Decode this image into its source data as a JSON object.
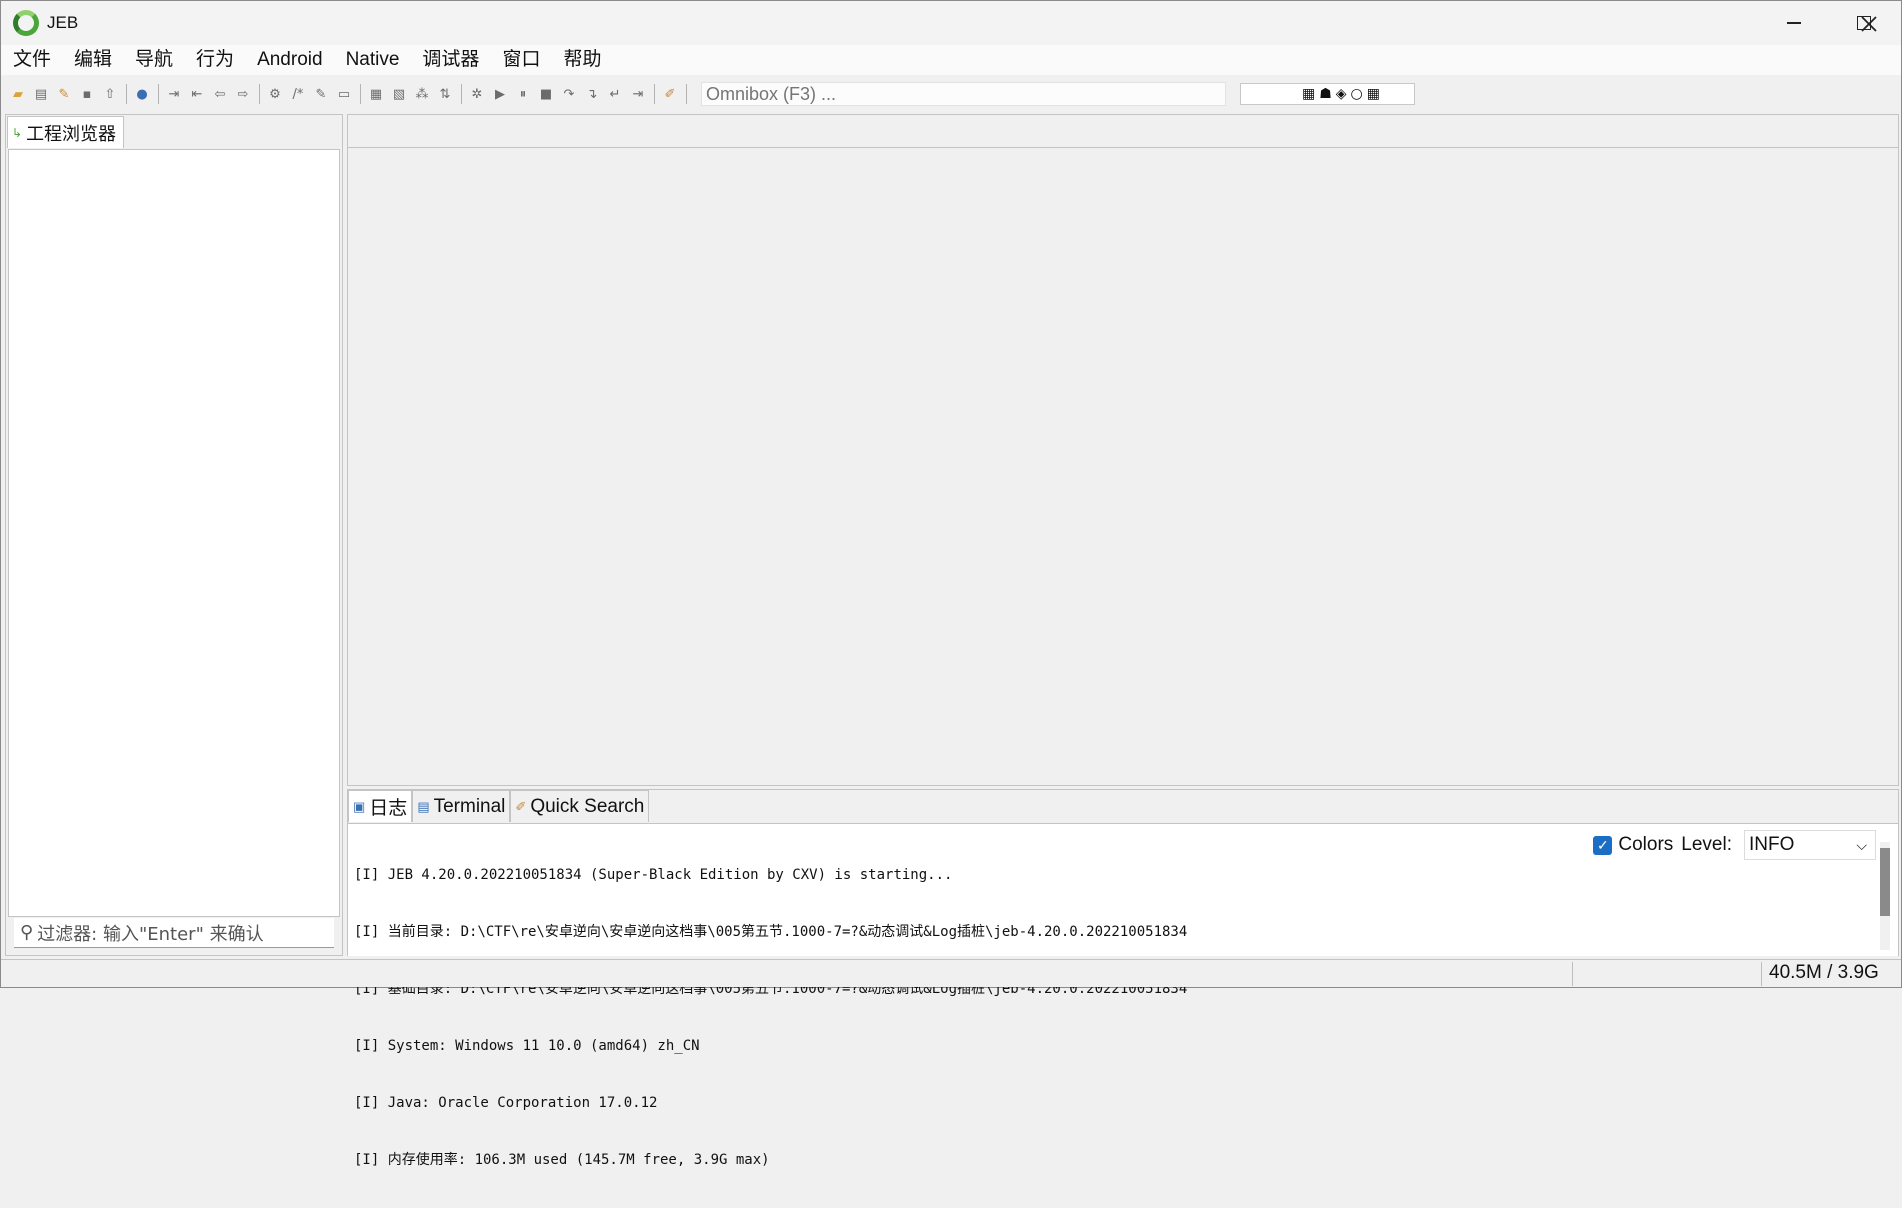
{
  "window": {
    "title": "JEB"
  },
  "menu": [
    "文件",
    "编辑",
    "导航",
    "行为",
    "Android",
    "Native",
    "调试器",
    "窗口",
    "帮助"
  ],
  "toolbar": {
    "omnibox_placeholder": "Omnibox (F3) ..."
  },
  "left_panel": {
    "tab_label": "工程浏览器",
    "filter_placeholder": "过滤器: 输入\"Enter\" 来确认"
  },
  "bottom_panel": {
    "tabs": [
      "日志",
      "Terminal",
      "Quick Search"
    ],
    "log_lines": [
      "[I] JEB 4.20.0.202210051834 (Super-Black Edition by CXV) is starting...",
      "[I] 当前目录: D:\\CTF\\re\\安卓逆向\\安卓逆向这档事\\005第五节.1000-7=?&动态调试&Log插桩\\jeb-4.20.0.202210051834",
      "[I] 基础目录: D:\\CTF\\re\\安卓逆向\\安卓逆向这档事\\005第五节.1000-7=?&动态调试&Log插桩\\jeb-4.20.0.202210051834",
      "[I] System: Windows 11 10.0 (amd64) zh_CN",
      "[I] Java: Oracle Corporation 17.0.12",
      "[I] 内存使用率: 106.3M used (145.7M free, 3.9G max)"
    ],
    "colors_label": "Colors",
    "level_label": "Level:",
    "level_value": "INFO"
  },
  "status_bar": {
    "memory": "40.5M / 3.9G"
  }
}
